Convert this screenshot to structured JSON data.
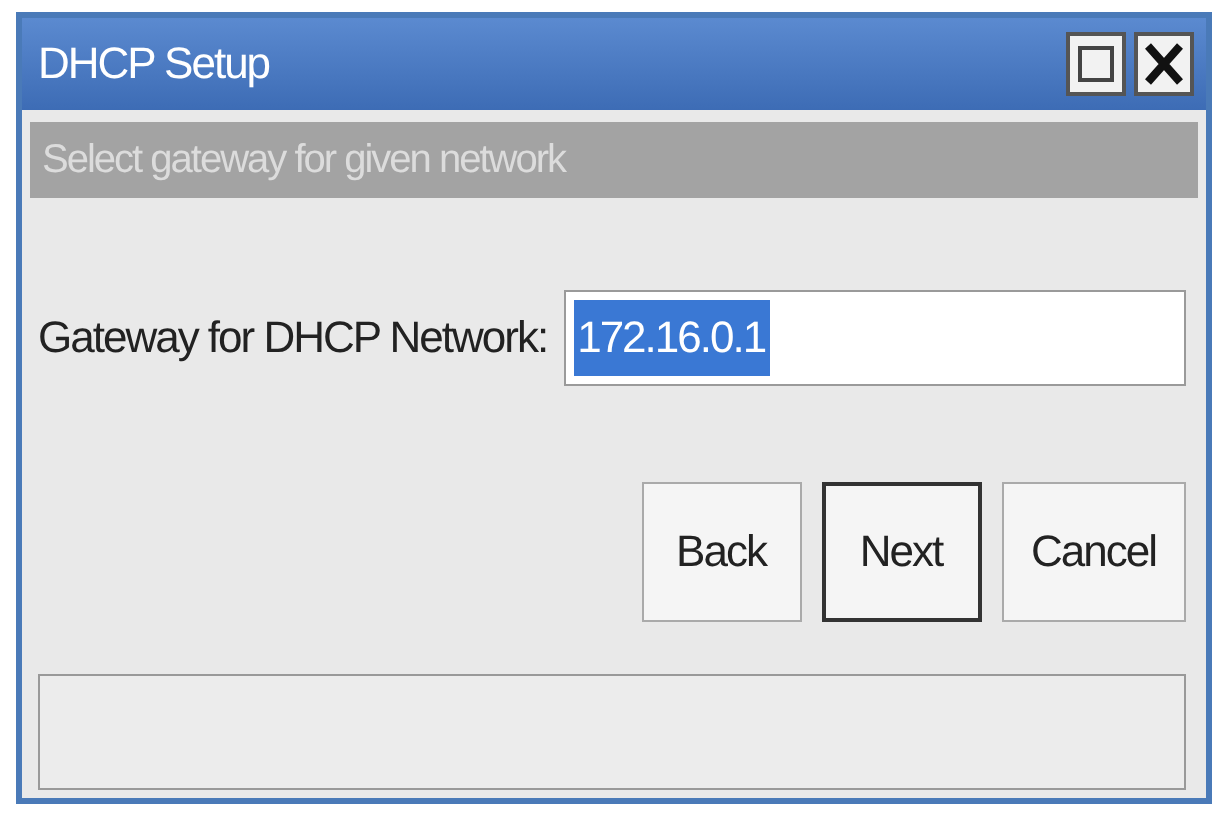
{
  "window": {
    "title": "DHCP Setup"
  },
  "title_buttons": [
    {
      "kind": "maximize"
    },
    {
      "kind": "close"
    }
  ],
  "header": "Select gateway for given network",
  "field": {
    "label": "Gateway for DHCP Network:",
    "value": "172.16.0.1",
    "text_selected": true
  },
  "buttons": [
    {
      "label": "Back",
      "focused": false
    },
    {
      "label": "Next",
      "focused": true
    },
    {
      "label": "Cancel",
      "focused": false
    }
  ]
}
